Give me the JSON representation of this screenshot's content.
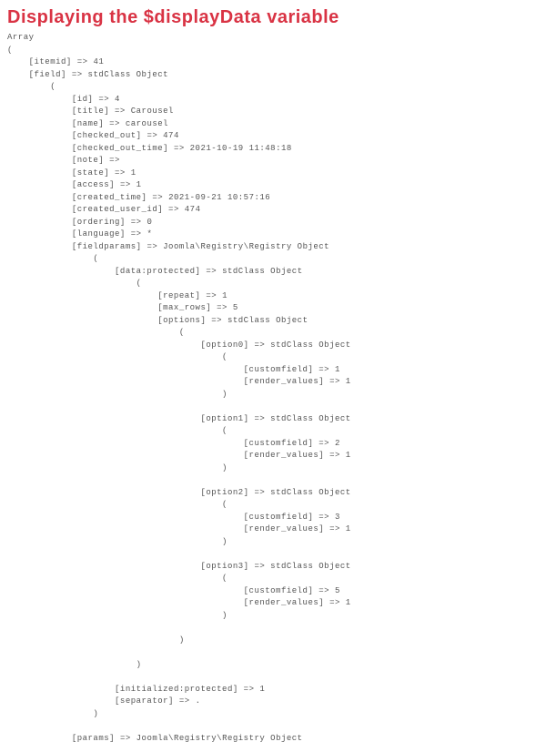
{
  "heading": "Displaying the $displayData variable",
  "dump": {
    "root_type": "Array",
    "open": "(",
    "close": ")",
    "itemid_key": "[itemid]",
    "itemid_val": "41",
    "field_key": "[field]",
    "field_type": "stdClass Object",
    "field": {
      "id_key": "[id]",
      "id_val": "4",
      "title_key": "[title]",
      "title_val": "Carousel",
      "name_key": "[name]",
      "name_val": "carousel",
      "checked_out_key": "[checked_out]",
      "checked_out_val": "474",
      "checked_out_time_key": "[checked_out_time]",
      "checked_out_time_val": "2021-10-19 11:48:18",
      "note_key": "[note]",
      "note_val": "",
      "state_key": "[state]",
      "state_val": "1",
      "access_key": "[access]",
      "access_val": "1",
      "created_time_key": "[created_time]",
      "created_time_val": "2021-09-21 10:57:16",
      "created_user_id_key": "[created_user_id]",
      "created_user_id_val": "474",
      "ordering_key": "[ordering]",
      "ordering_val": "0",
      "language_key": "[language]",
      "language_val": "*",
      "fieldparams_key": "[fieldparams]",
      "fieldparams_type": "Joomla\\Registry\\Registry Object",
      "fieldparams": {
        "data_key": "[data:protected]",
        "data_type": "stdClass Object",
        "data": {
          "repeat_key": "[repeat]",
          "repeat_val": "1",
          "max_rows_key": "[max_rows]",
          "max_rows_val": "5",
          "options_key": "[options]",
          "options_type": "stdClass Object",
          "options": {
            "option0_key": "[option0]",
            "option_type": "stdClass Object",
            "option1_key": "[option1]",
            "option2_key": "[option2]",
            "option3_key": "[option3]",
            "customfield_key": "[customfield]",
            "render_values_key": "[render_values]",
            "option0_customfield": "1",
            "option0_render": "1",
            "option1_customfield": "2",
            "option1_render": "1",
            "option2_customfield": "3",
            "option2_render": "1",
            "option3_customfield": "5",
            "option3_render": "1"
          }
        },
        "initialized_key": "[initialized:protected]",
        "initialized_val": "1",
        "separator_key": "[separator]",
        "separator_val": "."
      },
      "params_key": "[params]",
      "params_type": "Joomla\\Registry\\Registry Object"
    },
    "arrow": "=>"
  }
}
